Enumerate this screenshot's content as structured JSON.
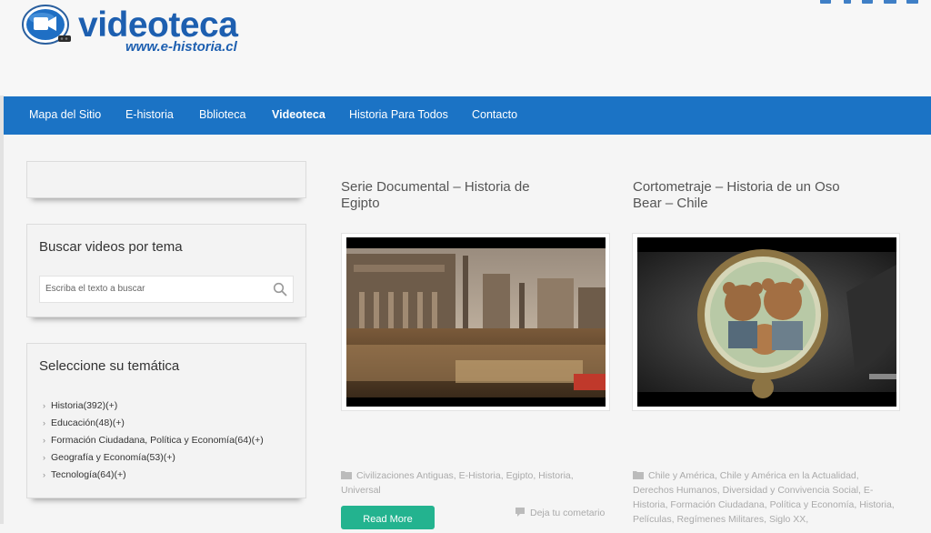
{
  "logo": {
    "title": "videoteca",
    "subtitle": "www.e-historia.cl",
    "icon": "video-camera-icon"
  },
  "social_icons": [
    "linkedin-icon",
    "google-plus-icon",
    "twitter-icon",
    "youtube-icon",
    "rss-icon"
  ],
  "nav": {
    "items": [
      {
        "label": "Mapa del Sitio",
        "active": false
      },
      {
        "label": "E-historia",
        "active": false
      },
      {
        "label": "Bblioteca",
        "active": false
      },
      {
        "label": "Videoteca",
        "active": true
      },
      {
        "label": "Historia Para Todos",
        "active": false
      },
      {
        "label": "Contacto",
        "active": false
      }
    ]
  },
  "sidebar": {
    "search": {
      "title": "Buscar videos por tema",
      "placeholder": "Escriba el texto a buscar",
      "value": ""
    },
    "topics": {
      "title": "Seleccione su temática",
      "items": [
        "Historia(392)(+)",
        "Educación(48)(+)",
        "Formación Ciudadana, Política y Economía(64)(+)",
        "Geografía y Economía(53)(+)",
        "Tecnología(64)(+)"
      ]
    }
  },
  "posts": [
    {
      "title": "Serie Documental – Historia de Egipto",
      "categories": "Civilizaciones Antiguas, E-Historia, Egipto, Historia, Universal",
      "read_more": "Read More",
      "comment": "Deja tu cometario"
    },
    {
      "title": "Cortometraje – Historia de un Oso Bear – Chile",
      "categories": "Chile y América, Chile y América en la Actualidad, Derechos Humanos, Diversidad y Convivencia Social, E-Historia, Formación Ciudadana, Política y Economía, Historia, Películas, Regímenes Militares, Siglo XX,"
    }
  ],
  "colors": {
    "nav": "#1b73c5",
    "brand": "#1d5fb0",
    "read_more": "#23b38f"
  }
}
